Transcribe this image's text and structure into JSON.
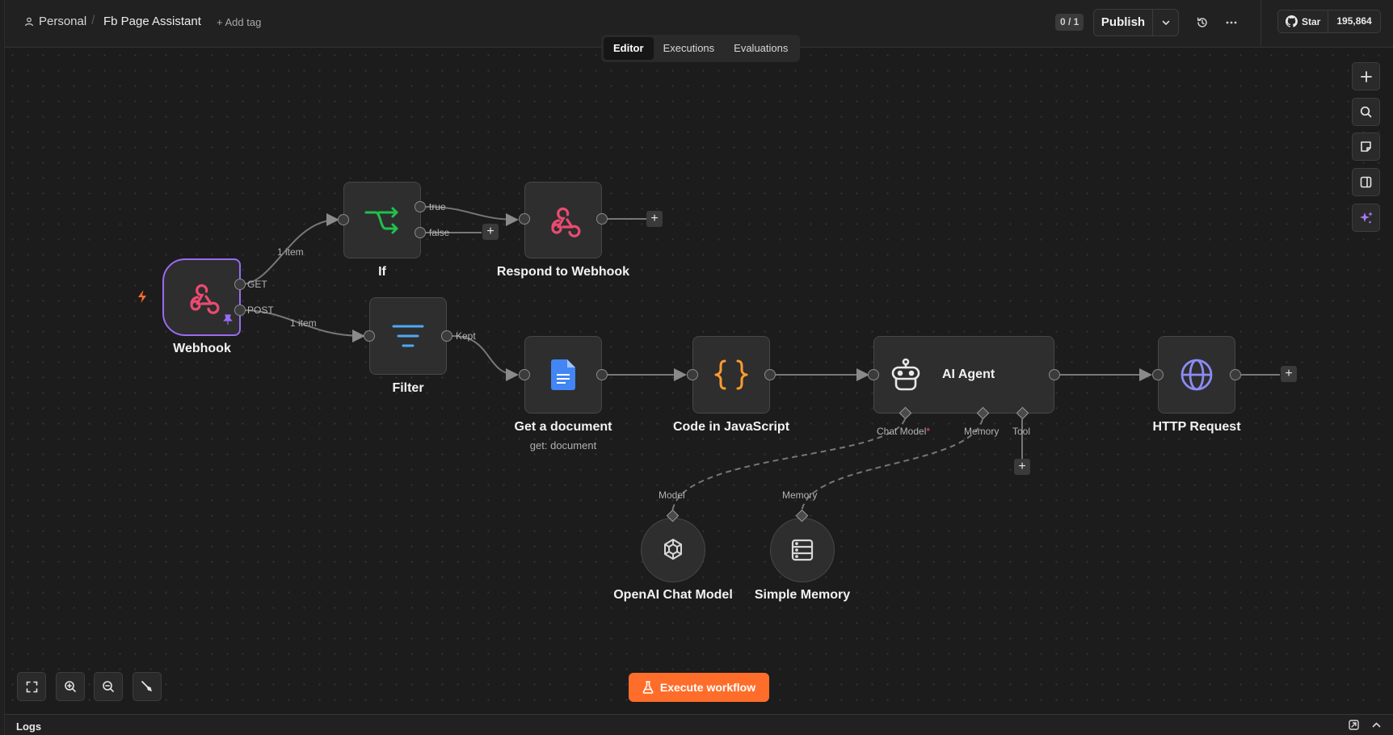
{
  "header": {
    "project": "Personal",
    "workflow_name": "Fb Page Assistant",
    "add_tag": "+ Add tag",
    "active_count": "0 / 1",
    "publish_label": "Publish",
    "github_star": "Star",
    "github_stars_count": "195,864"
  },
  "tabs": [
    {
      "label": "Editor",
      "active": true
    },
    {
      "label": "Executions",
      "active": false
    },
    {
      "label": "Evaluations",
      "active": false
    }
  ],
  "nodes": {
    "webhook": {
      "label": "Webhook",
      "outputs": [
        "GET",
        "POST"
      ],
      "icon": "webhook-icon"
    },
    "if": {
      "label": "If",
      "outputs": [
        "true",
        "false"
      ],
      "icon": "branch-icon"
    },
    "respond": {
      "label": "Respond to Webhook",
      "icon": "webhook-icon"
    },
    "filter": {
      "label": "Filter",
      "outputs": [
        "Kept"
      ],
      "icon": "filter-icon"
    },
    "get_document": {
      "label": "Get a document",
      "subtitle": "get: document",
      "icon": "google-docs-icon"
    },
    "code": {
      "label": "Code in JavaScript",
      "icon": "code-braces-icon"
    },
    "ai_agent": {
      "label": "AI Agent",
      "inputs": [
        "Chat Model",
        "Memory",
        "Tool"
      ],
      "required_mark": "*",
      "icon": "robot-icon"
    },
    "http": {
      "label": "HTTP Request",
      "icon": "globe-icon"
    },
    "openai": {
      "label": "OpenAI Chat Model",
      "handle": "Model",
      "icon": "openai-icon"
    },
    "memory": {
      "label": "Simple Memory",
      "handle": "Memory",
      "icon": "database-icon"
    }
  },
  "edge_labels": {
    "webhook_to_if": "1 item",
    "webhook_to_filter": "1 item"
  },
  "execute_button": "Execute workflow",
  "logs_label": "Logs",
  "colors": {
    "accent": "#ff6d2a",
    "selected_border": "#9a6bf2",
    "webhook_icon": "#ea4b71",
    "if_icon": "#1fc24b",
    "filter_icon": "#4ea8f5",
    "code_icon": "#ff9b2e",
    "http_icon": "#8b8bf5",
    "docs_icon": "#4285f4"
  }
}
